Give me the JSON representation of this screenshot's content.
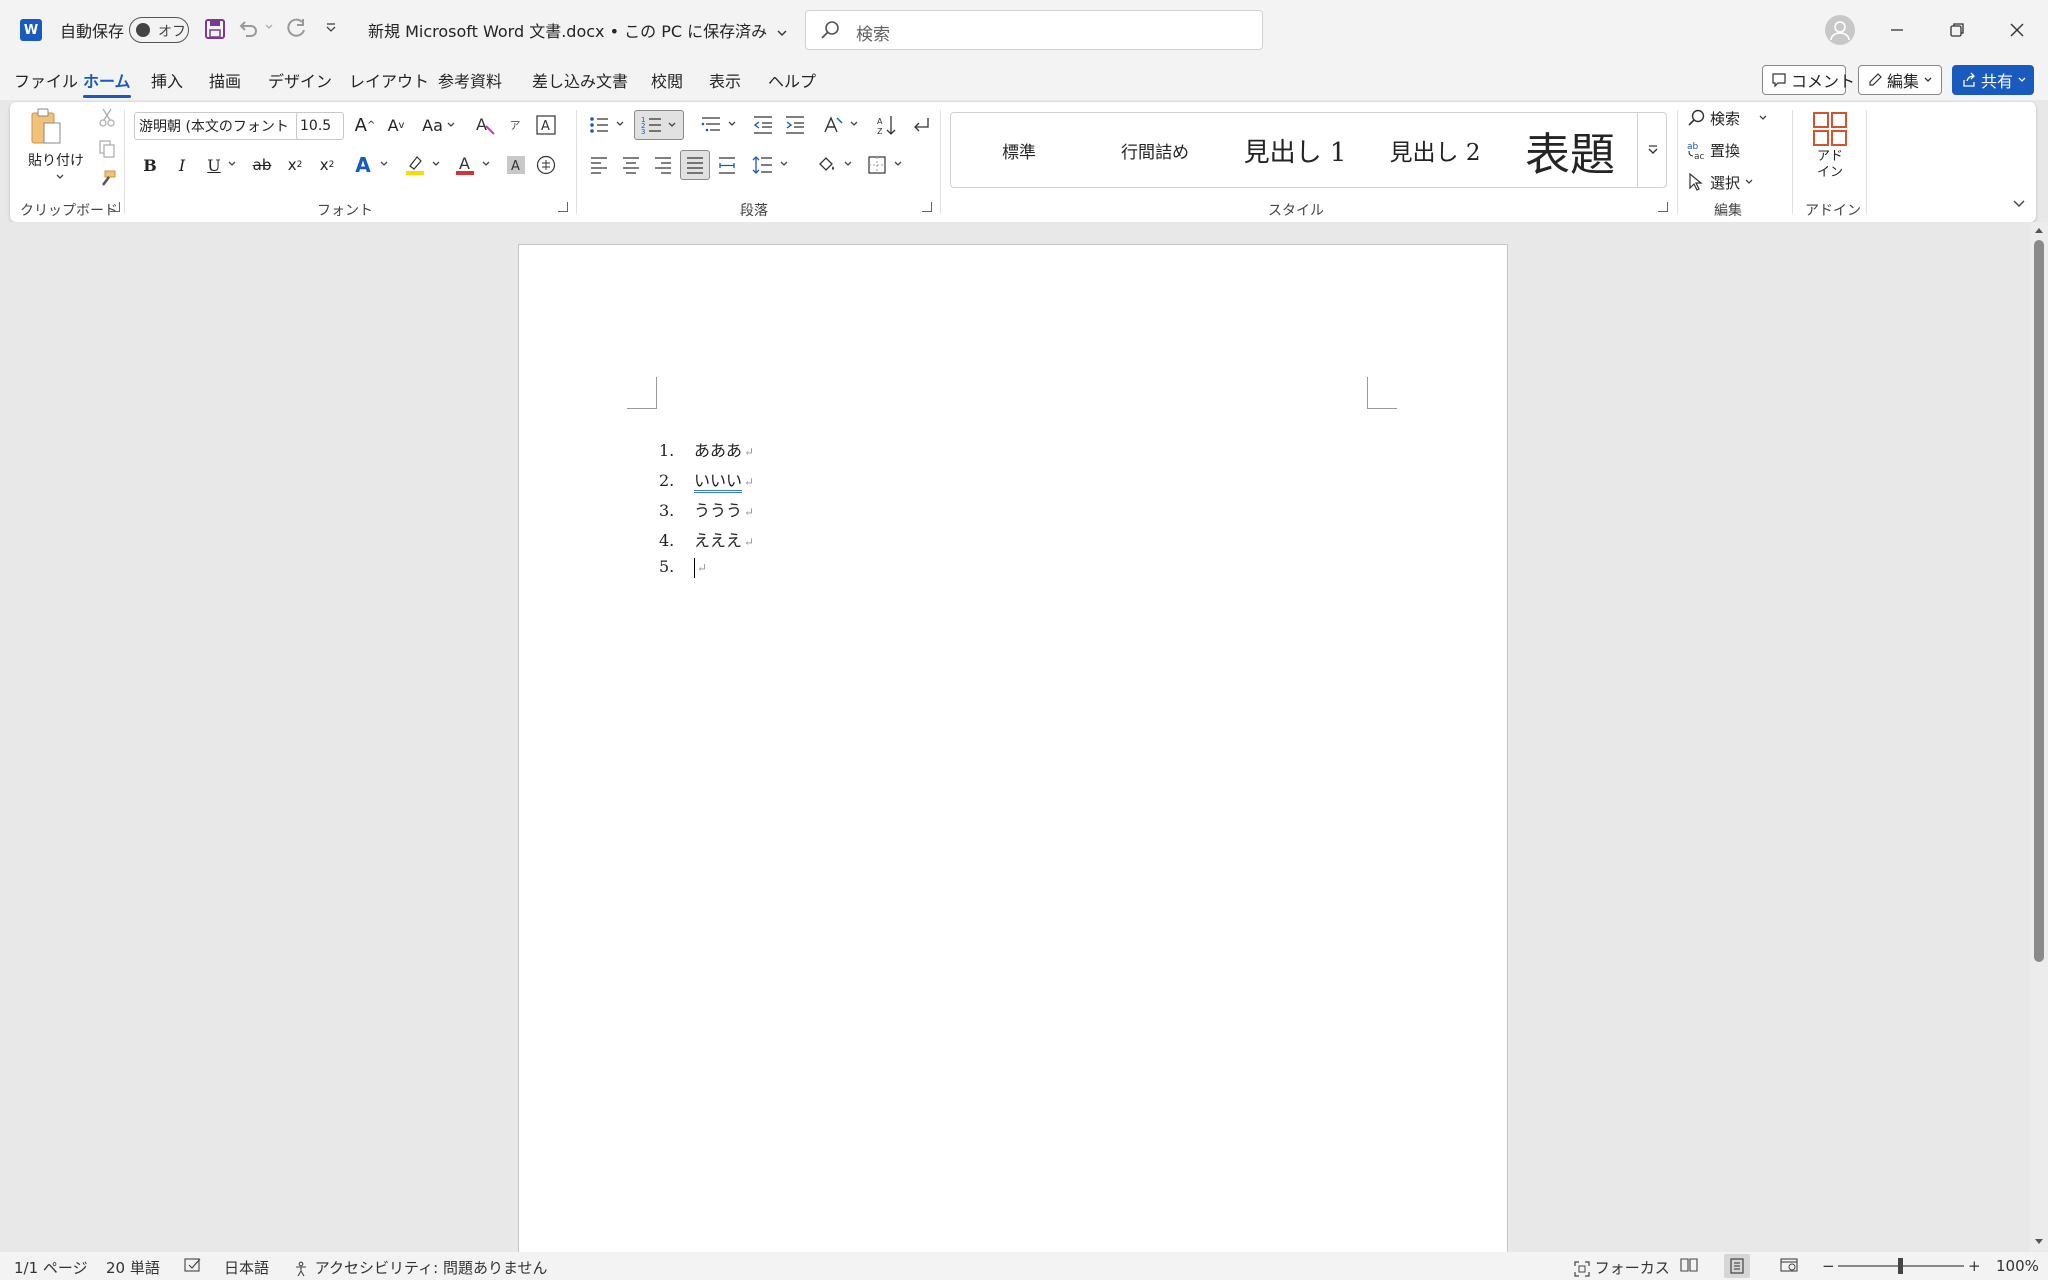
{
  "titlebar": {
    "autosave_label": "自動保存",
    "autosave_state": "オフ",
    "doc_title": "新規 Microsoft Word 文書.docx • この PC に保存済み",
    "search_placeholder": "検索"
  },
  "tabs": [
    "ファイル",
    "ホーム",
    "挿入",
    "描画",
    "デザイン",
    "レイアウト",
    "参考資料",
    "差し込み文書",
    "校閲",
    "表示",
    "ヘルプ"
  ],
  "active_tab": "ホーム",
  "top_buttons": {
    "comment": "コメント",
    "edit": "編集",
    "share": "共有"
  },
  "ribbon": {
    "clipboard": {
      "paste": "貼り付け",
      "label": "クリップボード"
    },
    "font": {
      "font_name": "游明朝 (本文のフォント",
      "font_size": "10.5",
      "label": "フォント",
      "case_btn": "Aa"
    },
    "paragraph": {
      "label": "段落"
    },
    "styles": {
      "items": [
        "標準",
        "行間詰め",
        "見出し 1",
        "見出し 2",
        "表題"
      ],
      "label": "スタイル"
    },
    "editing": {
      "find": "検索",
      "replace": "置換",
      "select": "選択",
      "label": "編集"
    },
    "addin": {
      "button": "アド\nイン",
      "label": "アドイン"
    }
  },
  "document": {
    "list": [
      {
        "num": "1.",
        "text": "あああ"
      },
      {
        "num": "2.",
        "text": "いいい"
      },
      {
        "num": "3.",
        "text": "ううう"
      },
      {
        "num": "4.",
        "text": "えええ"
      },
      {
        "num": "5.",
        "text": ""
      }
    ]
  },
  "statusbar": {
    "page": "1/1 ページ",
    "words": "20 単語",
    "language": "日本語",
    "accessibility": "アクセシビリティ: 問題ありません",
    "focus": "フォーカス",
    "zoom": "100%"
  },
  "colors": {
    "accent": "#185abd",
    "font_color": "#d13438",
    "highlight": "#ffd800"
  }
}
